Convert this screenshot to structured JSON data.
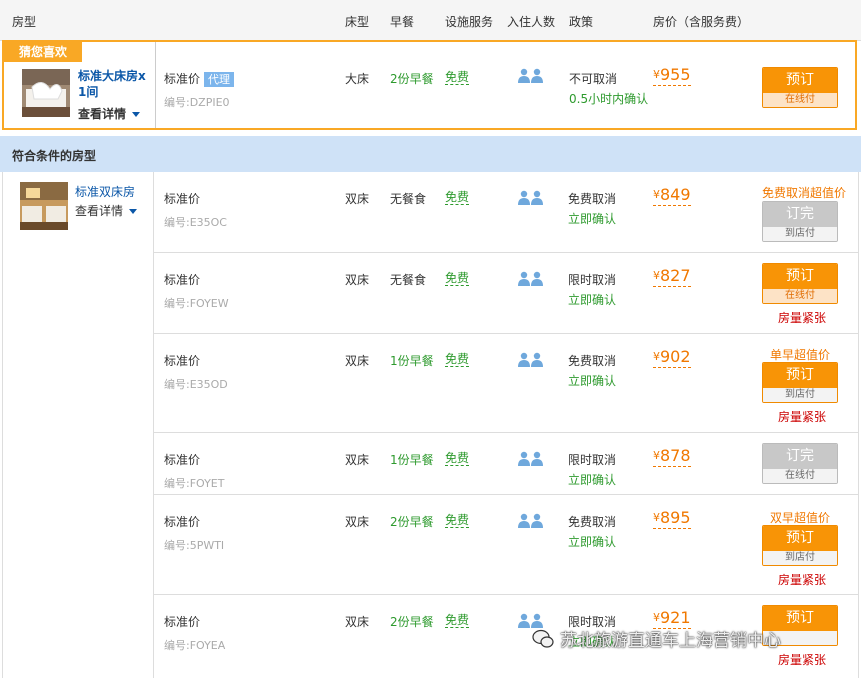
{
  "header": {
    "room_type": "房型",
    "bed_type": "床型",
    "breakfast": "早餐",
    "facilities": "设施服务",
    "occupancy": "入住人数",
    "policy": "政策",
    "price": "房价（含服务费）"
  },
  "featured": {
    "tag": "猜您喜欢",
    "room_name": "标准大床房x 1间",
    "detail_link": "查看详情",
    "plan": "标准价",
    "badge": "代理",
    "code": "编号:DZPIE0",
    "bed": "大床",
    "breakfast": "2份早餐",
    "service": "免费",
    "policy": "不可取消",
    "confirm": "0.5小时内确认",
    "currency": "¥",
    "price": "955",
    "button": "预订",
    "payment": "在线付"
  },
  "section_title": "符合条件的房型",
  "room": {
    "name": "标准双床房",
    "detail_link": "查看详情"
  },
  "rows": [
    {
      "plan": "标准价",
      "code": "编号:E35OC",
      "bed": "双床",
      "breakfast": "无餐食",
      "service": "免费",
      "policy": "免费取消",
      "confirm": "立即确认",
      "currency": "¥",
      "price": "849",
      "promo": "免费取消超值价",
      "button": "订完",
      "payment": "到店付",
      "tight": ""
    },
    {
      "plan": "标准价",
      "code": "编号:FOYEW",
      "bed": "双床",
      "breakfast": "无餐食",
      "service": "免费",
      "policy": "限时取消",
      "confirm": "立即确认",
      "currency": "¥",
      "price": "827",
      "promo": "",
      "button": "预订",
      "payment": "在线付",
      "tight": "房量紧张"
    },
    {
      "plan": "标准价",
      "code": "编号:E35OD",
      "bed": "双床",
      "breakfast": "1份早餐",
      "service": "免费",
      "policy": "免费取消",
      "confirm": "立即确认",
      "currency": "¥",
      "price": "902",
      "promo": "单早超值价",
      "button": "预订",
      "payment": "到店付",
      "tight": "房量紧张"
    },
    {
      "plan": "标准价",
      "code": "编号:FOYET",
      "bed": "双床",
      "breakfast": "1份早餐",
      "service": "免费",
      "policy": "限时取消",
      "confirm": "立即确认",
      "currency": "¥",
      "price": "878",
      "promo": "",
      "button": "订完",
      "payment": "在线付",
      "tight": ""
    },
    {
      "plan": "标准价",
      "code": "编号:5PWTI",
      "bed": "双床",
      "breakfast": "2份早餐",
      "service": "免费",
      "policy": "免费取消",
      "confirm": "立即确认",
      "currency": "¥",
      "price": "895",
      "promo": "双早超值价",
      "button": "预订",
      "payment": "到店付",
      "tight": "房量紧张"
    },
    {
      "plan": "标准价",
      "code": "编号:FOYEA",
      "bed": "双床",
      "breakfast": "2份早餐",
      "service": "免费",
      "policy": "限时取消",
      "confirm": "立即确认",
      "currency": "¥",
      "price": "921",
      "promo": "",
      "button": "预订",
      "payment": "",
      "tight": "房量紧张"
    }
  ],
  "watermark": "苏北旅游直通车上海营销中心",
  "colors": {
    "accent_orange": "#f89406",
    "featured_border": "#f9a825",
    "section_bg": "#cfe2f7",
    "price": "#f07800",
    "green": "#2e9a2e",
    "link_blue": "#0b57a8",
    "tight_red": "#cc0000",
    "disabled_gray": "#c8c8c8"
  }
}
